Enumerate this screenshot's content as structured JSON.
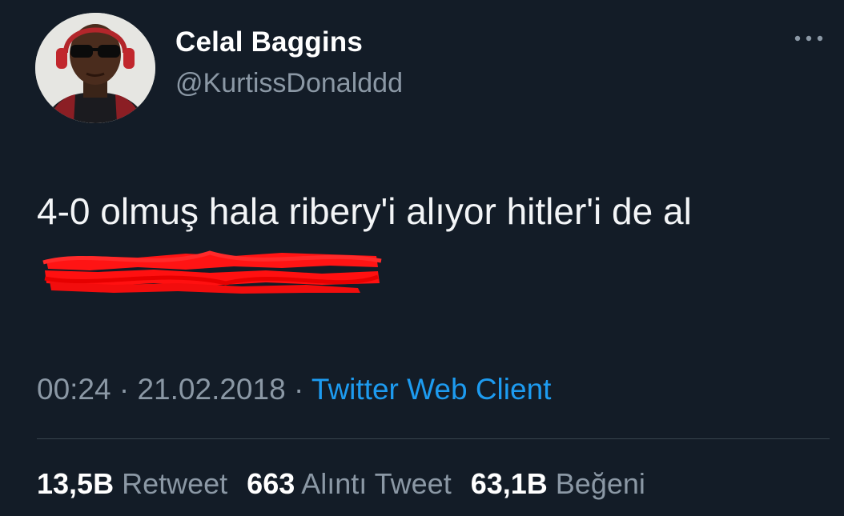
{
  "user": {
    "display_name": "Celal Baggins",
    "handle": "@KurtissDonalddd"
  },
  "tweet": {
    "text": "4-0 olmuş hala ribery'i alıyor hitler'i de al",
    "redacted": true
  },
  "meta": {
    "time": "00:24",
    "separator": "·",
    "date": "21.02.2018",
    "source": "Twitter Web Client"
  },
  "stats": {
    "retweets_count": "13,5B",
    "retweets_label": "Retweet",
    "quotes_count": "663",
    "quotes_label": "Alıntı Tweet",
    "likes_count": "63,1B",
    "likes_label": "Beğeni"
  },
  "icons": {
    "more": "more-options-icon",
    "avatar": "profile-photo"
  },
  "colors": {
    "background": "#131c27",
    "secondary_text": "#8b98a5",
    "link": "#1d9bf0",
    "redaction": "#ff0000"
  }
}
